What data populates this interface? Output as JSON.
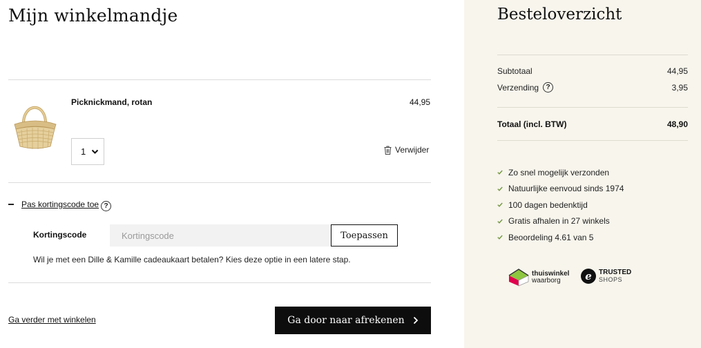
{
  "cart": {
    "title": "Mijn winkelmandje",
    "item": {
      "name": "Picknickmand, rotan",
      "price": "44,95",
      "quantity": "1",
      "remove_label": "Verwijder"
    },
    "discount": {
      "toggle_label": "Pas kortingscode toe",
      "code_label": "Kortingscode",
      "input_placeholder": "Kortingscode",
      "apply_label": "Toepassen",
      "giftcard_note": "Wil je met een Dille & Kamille cadeaukaart betalen? Kies deze optie in een latere stap."
    },
    "continue_label": "Ga verder met winkelen",
    "checkout_label": "Ga door naar afrekenen"
  },
  "summary": {
    "title": "Besteloverzicht",
    "subtotal_label": "Subtotaal",
    "subtotal_value": "44,95",
    "shipping_label": "Verzending",
    "shipping_value": "3,95",
    "total_label": "Totaal (incl. BTW)",
    "total_value": "48,90",
    "usps": [
      "Zo snel mogelijk verzonden",
      "Natuurlijke eenvoud sinds 1974",
      "100 dagen bedenktijd",
      "Gratis afhalen in 27 winkels",
      "Beoordeling 4.61 van 5"
    ],
    "badges": {
      "thuiswinkel_line1": "thuiswinkel",
      "thuiswinkel_line2": "waarborg",
      "trusted_line1": "TRUSTED",
      "trusted_line2": "SHOPS"
    }
  },
  "colors": {
    "sidebar_bg": "#f7f5ec",
    "button_dark": "#0d0d0d",
    "check_green": "#7a9a4a",
    "thuiswinkel_red": "#e0004d",
    "thuiswinkel_green": "#8dc63f"
  },
  "icons": {
    "help": "question-circle-icon",
    "trash": "trash-icon",
    "chevron_down": "chevron-down-icon",
    "chevron_right": "chevron-right-icon",
    "check": "check-icon"
  }
}
